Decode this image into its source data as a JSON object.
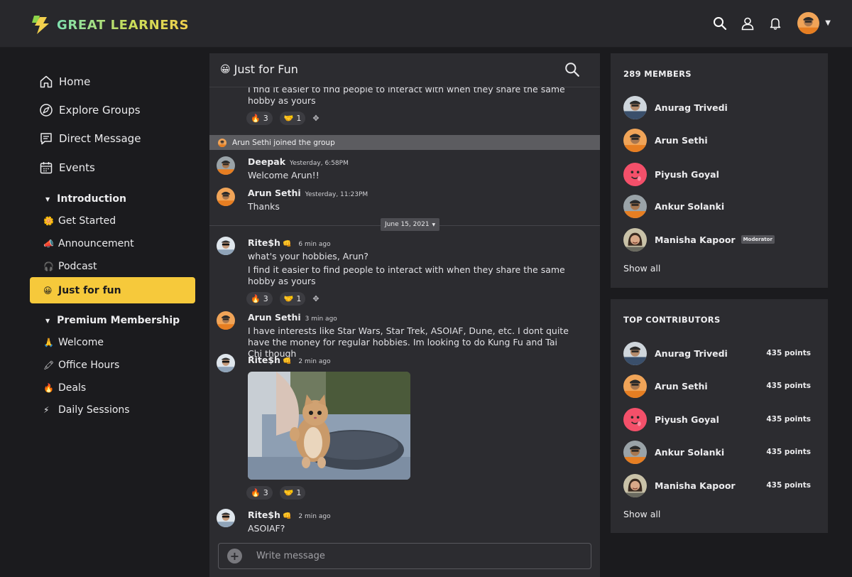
{
  "brand": {
    "name": "GREAT LEARNERS"
  },
  "sidebar": {
    "nav": [
      {
        "label": "Home",
        "icon": "home-icon"
      },
      {
        "label": "Explore Groups",
        "icon": "compass-icon"
      },
      {
        "label": "Direct Message",
        "icon": "message-icon"
      },
      {
        "label": "Events",
        "icon": "calendar-icon"
      }
    ],
    "sections": [
      {
        "title": "Introduction",
        "channels": [
          {
            "emoji": "🌼",
            "label": "Get Started"
          },
          {
            "emoji": "📣",
            "label": "Announcement"
          },
          {
            "emoji": "🎧",
            "label": "Podcast"
          },
          {
            "emoji": "😀",
            "label": "Just for fun",
            "active": true
          }
        ]
      },
      {
        "title": "Premium Membership",
        "channels": [
          {
            "emoji": "🙏",
            "label": "Welcome"
          },
          {
            "emoji": "🖍",
            "label": "Office Hours"
          },
          {
            "emoji": "🔥",
            "label": "Deals"
          },
          {
            "emoji": "⚡",
            "label": "Daily Sessions"
          }
        ]
      }
    ]
  },
  "chat": {
    "title_emoji": "😀",
    "title": "Just for Fun",
    "top_partial_text": "I find it easier to find people to interact with when they share the same hobby as yours",
    "top_reactions": [
      {
        "emoji": "🔥",
        "count": "3"
      },
      {
        "emoji": "🤝",
        "count": "1"
      }
    ],
    "join_notice": "Arun Sethi joined the group",
    "date_separator": "June 15, 2021",
    "messages": [
      {
        "author": "Deepak",
        "time": "Yesterday, 6:58PM",
        "text": "Welcome Arun!!"
      },
      {
        "author": "Arun Sethi",
        "time": "Yesterday, 11:23PM",
        "text": "Thanks"
      },
      {
        "author": "Rite$h",
        "author_emoji": "👊",
        "time": "6 min ago",
        "text": "what's your hobbies, Arun?",
        "text2": "I find it easier to find people to interact with when they share the same hobby as yours",
        "reactions": [
          {
            "emoji": "🔥",
            "count": "3"
          },
          {
            "emoji": "🤝",
            "count": "1"
          }
        ]
      },
      {
        "author": "Arun Sethi",
        "time": "3 min ago",
        "text": "I have interests like Star Wars, Star Trek, ASOIAF, Dune, etc. I dont quite have the money for regular hobbies. Im looking to do Kung Fu and Tai Chi though"
      },
      {
        "author": "Rite$h",
        "author_emoji": "👊",
        "time": "2 min ago",
        "reactions": [
          {
            "emoji": "🔥",
            "count": "3"
          },
          {
            "emoji": "🤝",
            "count": "1"
          }
        ]
      },
      {
        "author": "Rite$h",
        "author_emoji": "👊",
        "time": "2 min ago",
        "text": "ASOIAF?"
      }
    ],
    "composer": {
      "placeholder": "Write message"
    }
  },
  "members": {
    "title": "289 MEMBERS",
    "list": [
      {
        "name": "Anurag Trivedi"
      },
      {
        "name": "Arun Sethi"
      },
      {
        "name": "Piyush Goyal"
      },
      {
        "name": "Ankur Solanki"
      },
      {
        "name": "Manisha Kapoor",
        "badge": "Moderator"
      }
    ],
    "show_all": "Show all"
  },
  "contributors": {
    "title": "TOP CONTRIBUTORS",
    "list": [
      {
        "name": "Anurag Trivedi",
        "points": "435 points"
      },
      {
        "name": "Arun Sethi",
        "points": "435 points"
      },
      {
        "name": "Piyush Goyal",
        "points": "435 points"
      },
      {
        "name": "Ankur Solanki",
        "points": "435 points"
      },
      {
        "name": "Manisha Kapoor",
        "points": "435 points"
      }
    ],
    "show_all": "Show all"
  },
  "colors": {
    "accent": "#f6c93b",
    "background": "#1b1b1e",
    "panel": "#2c2c30",
    "topbar": "#28282c"
  }
}
